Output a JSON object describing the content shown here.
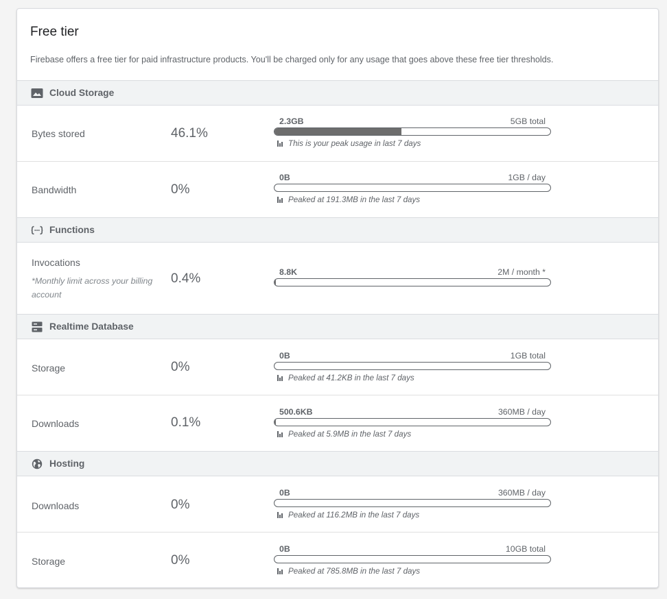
{
  "card": {
    "title": "Free tier",
    "description": "Firebase offers a free tier for paid infrastructure products. You'll be charged only for any usage that goes above these free tier thresholds."
  },
  "colors": {
    "bar_fill": "#6d6d6d",
    "header_bg": "#f1f3f4",
    "text": "#5f6368"
  },
  "sections": [
    {
      "label": "Cloud Storage",
      "icon": "image-icon",
      "rows": [
        {
          "metric": "Bytes stored",
          "percent": "46.1%",
          "used": "2.3GB",
          "limit": "5GB total",
          "fraction": 0.461,
          "peak": "This is your peak usage in last 7 days"
        },
        {
          "metric": "Bandwidth",
          "percent": "0%",
          "used": "0B",
          "limit": "1GB / day",
          "fraction": 0,
          "peak": "Peaked at 191.3MB in the last 7 days"
        }
      ]
    },
    {
      "label": "Functions",
      "icon": "functions-icon",
      "rows": [
        {
          "metric": "Invocations",
          "note": "*Monthly limit across your billing account",
          "percent": "0.4%",
          "used": "8.8K",
          "limit": "2M / month *",
          "fraction": 0.004
        }
      ]
    },
    {
      "label": "Realtime Database",
      "icon": "database-icon",
      "rows": [
        {
          "metric": "Storage",
          "percent": "0%",
          "used": "0B",
          "limit": "1GB total",
          "fraction": 0,
          "peak": "Peaked at 41.2KB in the last 7 days"
        },
        {
          "metric": "Downloads",
          "percent": "0.1%",
          "used": "500.6KB",
          "limit": "360MB / day",
          "fraction": 0.001,
          "peak": "Peaked at 5.9MB in the last 7 days"
        }
      ]
    },
    {
      "label": "Hosting",
      "icon": "globe-icon",
      "rows": [
        {
          "metric": "Downloads",
          "percent": "0%",
          "used": "0B",
          "limit": "360MB / day",
          "fraction": 0,
          "peak": "Peaked at 116.2MB in the last 7 days"
        },
        {
          "metric": "Storage",
          "percent": "0%",
          "used": "0B",
          "limit": "10GB total",
          "fraction": 0,
          "peak": "Peaked at 785.8MB in the last 7 days"
        }
      ]
    }
  ]
}
